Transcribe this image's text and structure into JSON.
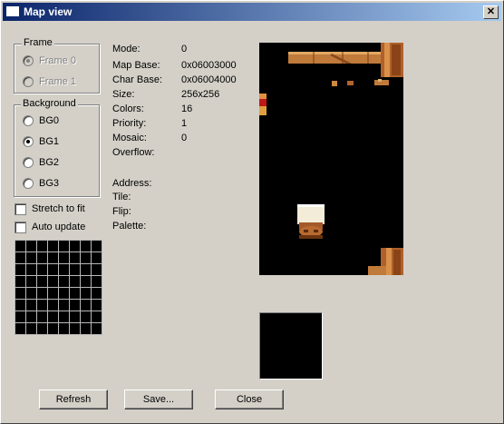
{
  "window": {
    "title": "Map view",
    "close_glyph": "✕"
  },
  "frame_group": {
    "legend": "Frame",
    "options": [
      {
        "label": "Frame 0",
        "selected": true
      },
      {
        "label": "Frame 1",
        "selected": false
      }
    ]
  },
  "background_group": {
    "legend": "Background",
    "options": [
      {
        "label": "BG0",
        "selected": false
      },
      {
        "label": "BG1",
        "selected": true
      },
      {
        "label": "BG2",
        "selected": false
      },
      {
        "label": "BG3",
        "selected": false
      }
    ]
  },
  "options": {
    "stretch_label": "Stretch to fit",
    "auto_update_label": "Auto update"
  },
  "info": {
    "mode_label": "Mode:",
    "mode_value": "0",
    "mapbase_label": "Map Base:",
    "mapbase_value": "0x06003000",
    "charbase_label": "Char Base:",
    "charbase_value": "0x06004000",
    "size_label": "Size:",
    "size_value": "256x256",
    "colors_label": "Colors:",
    "colors_value": "16",
    "priority_label": "Priority:",
    "priority_value": "1",
    "mosaic_label": "Mosaic:",
    "mosaic_value": "0",
    "overflow_label": "Overflow:",
    "address_label": "Address:",
    "tile_label": "Tile:",
    "flip_label": "Flip:",
    "palette_label": "Palette:"
  },
  "buttons": {
    "refresh": "Refresh",
    "save": "Save...",
    "close": "Close"
  },
  "colors": {
    "wood": "#b8642a",
    "wood_light": "#d98f45",
    "beam": "#e0b070"
  }
}
